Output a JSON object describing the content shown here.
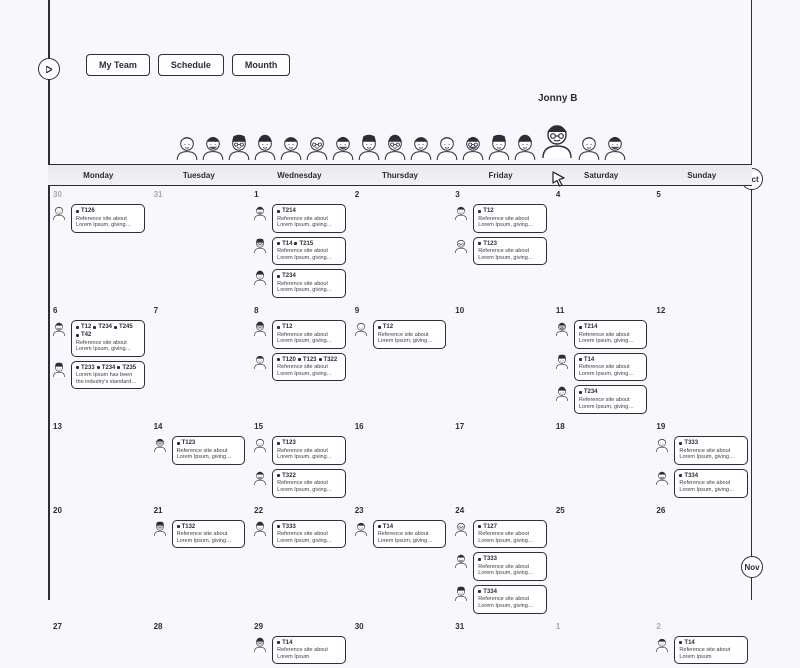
{
  "pills": {
    "team": "My Team",
    "schedule": "Schedule",
    "month": "Mounth"
  },
  "focus_user": "Jonny B",
  "months": {
    "oct": "Oct",
    "nov": "Nov"
  },
  "daynames": [
    "Monday",
    "Tuesday",
    "Wednesday",
    "Thursday",
    "Friday",
    "Saturday",
    "Sunday"
  ],
  "team_avatars": [
    1,
    2,
    3,
    4,
    5,
    6,
    7,
    8,
    9,
    10,
    11,
    12,
    13,
    14,
    15,
    16,
    17
  ],
  "cells": [
    {
      "n": "30",
      "muted": true,
      "tasks": [
        {
          "av": 1,
          "tags": [
            "T126"
          ],
          "desc": "Reference site about Lorem Ipsum, giving information on ..."
        }
      ]
    },
    {
      "n": "31",
      "muted": true,
      "tasks": []
    },
    {
      "n": "1",
      "tasks": [
        {
          "av": 2,
          "tags": [
            "T214"
          ],
          "desc": "Reference site about Lorem Ipsum, giving information on it..."
        },
        {
          "av": 3,
          "tags": [
            "T14",
            "T215"
          ],
          "desc": "Reference site about Lorem Ipsum, giving information on it..."
        },
        {
          "av": 4,
          "tags": [
            "T234"
          ],
          "desc": "Reference site about Lorem Ipsum, giving origins."
        }
      ]
    },
    {
      "n": "2",
      "tasks": []
    },
    {
      "n": "3",
      "tasks": [
        {
          "av": 5,
          "tags": [
            "T12"
          ],
          "desc": "Reference site about Lorem Ipsum, giving information on it..."
        },
        {
          "av": 6,
          "tags": [
            "T123"
          ],
          "desc": "Reference site about Lorem Ipsum, giving information."
        }
      ]
    },
    {
      "n": "4",
      "tasks": []
    },
    {
      "n": "5",
      "tasks": []
    },
    {
      "n": "6",
      "tasks": [
        {
          "av": 7,
          "tags": [
            "T12",
            "T234",
            "T245",
            "T42"
          ],
          "desc": "Reference site about Lorem Ipsum, giving information on ..."
        },
        {
          "av": 8,
          "tags": [
            "T233",
            "T234",
            "T235"
          ],
          "desc": "Lorem Ipsum has been the industry's standard dummy tex..."
        }
      ]
    },
    {
      "n": "7",
      "tasks": []
    },
    {
      "n": "8",
      "tasks": [
        {
          "av": 9,
          "tags": [
            "T12"
          ],
          "desc": "Reference site about Lorem Ipsum, giving information on it..."
        },
        {
          "av": 10,
          "tags": [
            "T120",
            "T123",
            "T322"
          ],
          "desc": "Reference site about Lorem Ipsum, giving information."
        }
      ]
    },
    {
      "n": "9",
      "tasks": [
        {
          "av": 11,
          "tags": [
            "T12"
          ],
          "desc": "Reference site about Lorem Ipsum, giving information on it..."
        }
      ]
    },
    {
      "n": "10",
      "tasks": []
    },
    {
      "n": "11",
      "tasks": [
        {
          "av": 12,
          "tags": [
            "T214"
          ],
          "desc": "Reference site about Lorem Ipsum, giving information on it..."
        },
        {
          "av": 13,
          "tags": [
            "T14"
          ],
          "desc": "Reference site about Lorem Ipsum, giving information."
        },
        {
          "av": 14,
          "tags": [
            "T234"
          ],
          "desc": "Reference site about Lorem Ipsum, giving information origins."
        }
      ]
    },
    {
      "n": "12",
      "tasks": []
    },
    {
      "n": "13",
      "tasks": []
    },
    {
      "n": "14",
      "tasks": [
        {
          "av": 15,
          "tags": [
            "T123"
          ],
          "desc": "Reference site about Lorem Ipsum, giving information on it..."
        }
      ]
    },
    {
      "n": "15",
      "tasks": [
        {
          "av": 16,
          "tags": [
            "T123"
          ],
          "desc": "Reference site about Lorem Ipsum, giving information."
        },
        {
          "av": 17,
          "tags": [
            "T322"
          ],
          "desc": "Reference site about Lorem Ipsum, giving information."
        }
      ]
    },
    {
      "n": "16",
      "tasks": []
    },
    {
      "n": "17",
      "tasks": []
    },
    {
      "n": "18",
      "tasks": []
    },
    {
      "n": "19",
      "tasks": [
        {
          "av": 1,
          "tags": [
            "T333"
          ],
          "desc": "Reference site about Lorem Ipsum, giving information."
        },
        {
          "av": 2,
          "tags": [
            "T334"
          ],
          "desc": "Reference site about Lorem Ipsum, giving information origins."
        }
      ]
    },
    {
      "n": "20",
      "tasks": []
    },
    {
      "n": "21",
      "tasks": [
        {
          "av": 3,
          "tags": [
            "T132"
          ],
          "desc": "Reference site about Lorem Ipsum, giving information on it..."
        }
      ]
    },
    {
      "n": "22",
      "tasks": [
        {
          "av": 4,
          "tags": [
            "T333"
          ],
          "desc": "Reference site about Lorem Ipsum, giving information."
        }
      ]
    },
    {
      "n": "23",
      "tasks": [
        {
          "av": 5,
          "tags": [
            "T14"
          ],
          "desc": "Reference site about Lorem Ipsum, giving information."
        }
      ]
    },
    {
      "n": "24",
      "tasks": [
        {
          "av": 6,
          "tags": [
            "T127"
          ],
          "desc": "Reference site about Lorem Ipsum, giving information."
        },
        {
          "av": 7,
          "tags": [
            "T333"
          ],
          "desc": "Reference site about Lorem Ipsum, giving information."
        },
        {
          "av": 8,
          "tags": [
            "T334"
          ],
          "desc": "Reference site about Lorem Ipsum, giving information origins."
        }
      ]
    },
    {
      "n": "25",
      "tasks": []
    },
    {
      "n": "26",
      "tasks": []
    },
    {
      "n": "27",
      "tasks": []
    },
    {
      "n": "28",
      "tasks": []
    },
    {
      "n": "29",
      "tasks": [
        {
          "av": 9,
          "tags": [
            "T14"
          ],
          "desc": "Reference site about Lorem Ipsum"
        }
      ]
    },
    {
      "n": "30",
      "tasks": []
    },
    {
      "n": "31",
      "tasks": []
    },
    {
      "n": "1",
      "muted": true,
      "tasks": []
    },
    {
      "n": "2",
      "muted": true,
      "tasks": [
        {
          "av": 10,
          "tags": [
            "T14"
          ],
          "desc": "Reference site about Lorem Ipsum"
        }
      ]
    }
  ]
}
